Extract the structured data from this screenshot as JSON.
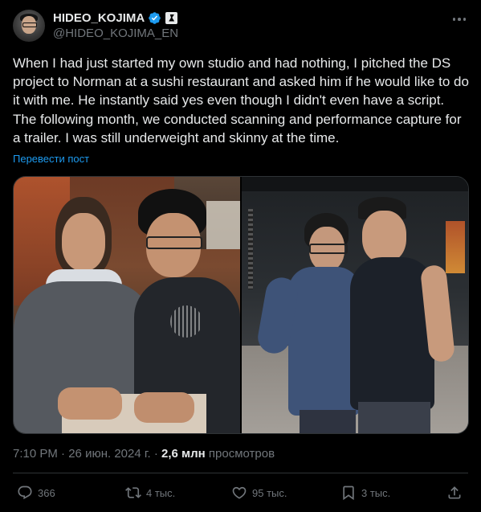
{
  "author": {
    "display_name": "HIDEO_KOJIMA",
    "handle": "@HIDEO_KOJIMA_EN",
    "verified_color": "#1d9bf0"
  },
  "tweet": {
    "text": "When I had just started my own studio and had nothing, I pitched the DS project to Norman at a sushi restaurant and asked him if he would like to do it with me. He instantly said yes even though I didn't even have a script. The following month, we conducted scanning and performance capture for a trailer. I was still underweight and skinny at the time.",
    "translate_label": "Перевести пост",
    "time": "7:10 PM",
    "date": "26 июн. 2024 г.",
    "views_count": "2,6 млн",
    "views_label": "просмотров"
  },
  "actions": {
    "replies": "366",
    "reposts": "4 тыс.",
    "likes": "95 тыс.",
    "bookmarks": "3 тыс."
  },
  "icons": [
    "verified-icon",
    "affiliate-badge-icon",
    "more-icon",
    "reply-icon",
    "repost-icon",
    "like-icon",
    "bookmark-icon",
    "share-icon"
  ],
  "colors": {
    "background": "#000000",
    "text": "#e7e9ea",
    "secondary": "#71767b",
    "link": "#1d9bf0",
    "border": "#2f3336"
  }
}
